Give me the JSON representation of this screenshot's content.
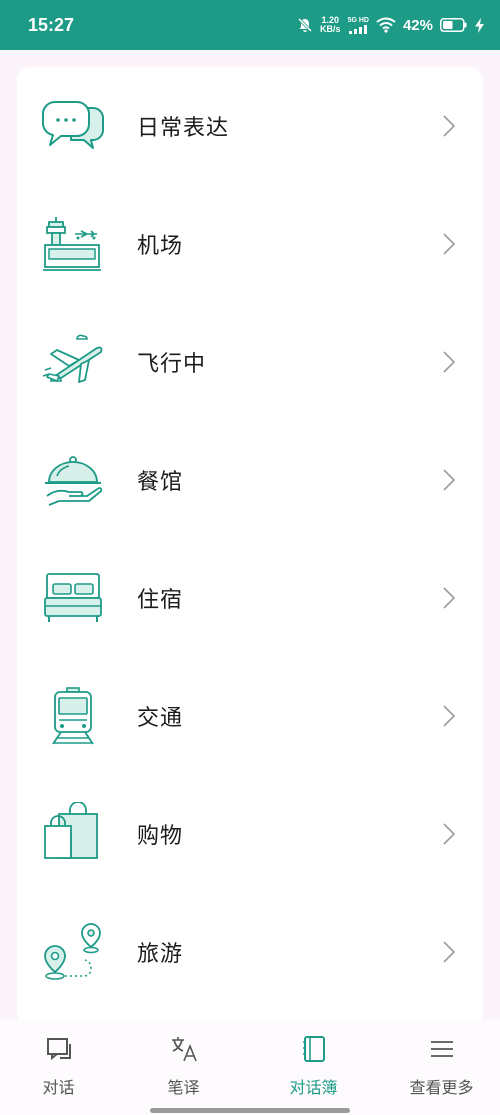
{
  "status_bar": {
    "time": "15:27",
    "net_speed_value": "1.20",
    "net_speed_unit": "KB/s",
    "signal_label": "5G HD",
    "battery_percent": "42%"
  },
  "list": [
    {
      "label": "日常表达",
      "icon": "chat-bubbles-icon"
    },
    {
      "label": "机场",
      "icon": "airport-icon"
    },
    {
      "label": "飞行中",
      "icon": "airplane-icon"
    },
    {
      "label": "餐馆",
      "icon": "restaurant-cloche-icon"
    },
    {
      "label": "住宿",
      "icon": "bed-icon"
    },
    {
      "label": "交通",
      "icon": "train-icon"
    },
    {
      "label": "购物",
      "icon": "shopping-bags-icon"
    },
    {
      "label": "旅游",
      "icon": "map-route-icon"
    }
  ],
  "bottom_nav": [
    {
      "label": "对话",
      "icon": "conversation-icon",
      "active": false
    },
    {
      "label": "笔译",
      "icon": "translate-icon",
      "active": false
    },
    {
      "label": "对话簿",
      "icon": "phrasebook-icon",
      "active": true
    },
    {
      "label": "查看更多",
      "icon": "menu-icon",
      "active": false
    }
  ],
  "colors": {
    "accent": "#1d9b87",
    "icon_fill": "#d7f0ea",
    "text": "#1c1c1c"
  }
}
